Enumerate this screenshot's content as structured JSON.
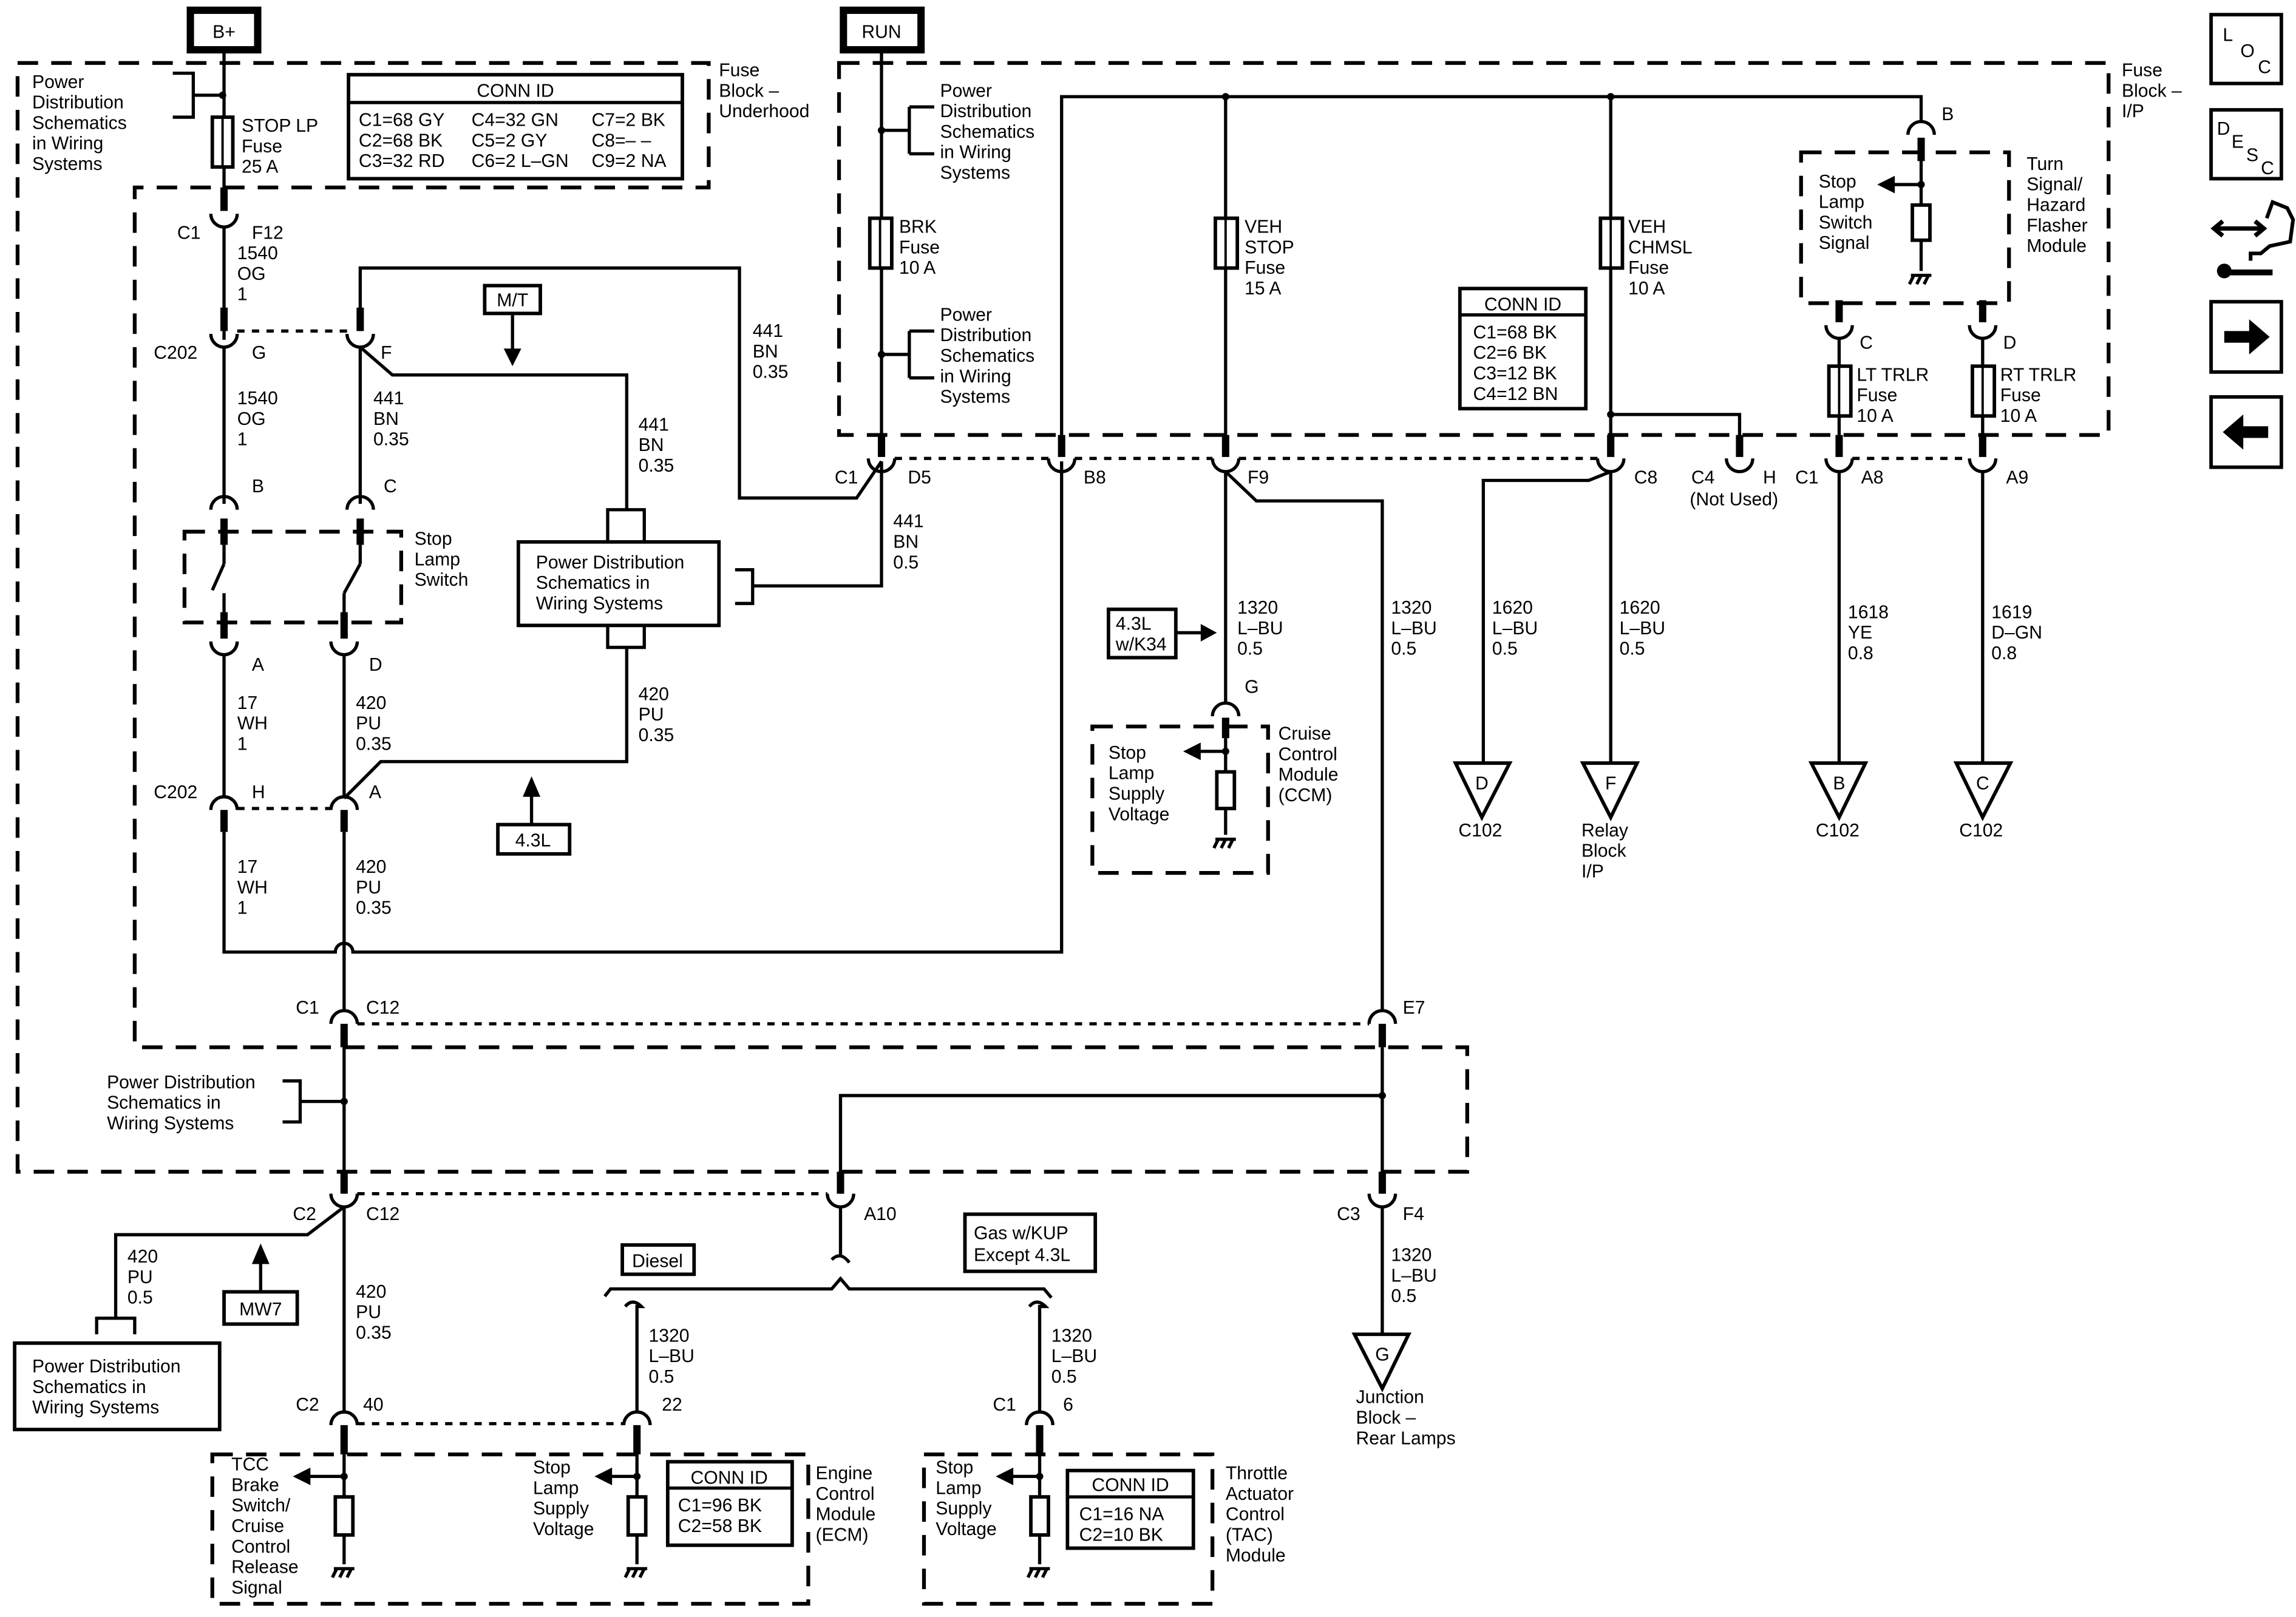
{
  "power_sources": {
    "bplus": "B+",
    "run": "RUN"
  },
  "fuse_block_underhood": {
    "label": [
      "Fuse",
      "Block –",
      "Underhood"
    ],
    "pds_ref": [
      "Power",
      "Distribution",
      "Schematics",
      "in Wiring",
      "Systems"
    ],
    "fuse": [
      "STOP LP",
      "Fuse",
      "25 A"
    ],
    "conn_id": {
      "title": "CONN ID",
      "rows": [
        [
          "C1=68 GY",
          "C4=32 GN",
          "C7=2 BK"
        ],
        [
          "C2=68 BK",
          "C5=2 GY",
          "C8=– –"
        ],
        [
          "C3=32 RD",
          "C6=2 L–GN",
          "C9=2 NA"
        ]
      ]
    },
    "conn_c1": "C1",
    "pin_f12": "F12"
  },
  "fuse_block_ip": {
    "label": [
      "Fuse",
      "Block –",
      "I/P"
    ],
    "pds_ref_1": [
      "Power",
      "Distribution",
      "Schematics",
      "in Wiring",
      "Systems"
    ],
    "pds_ref_2": [
      "Power",
      "Distribution",
      "Schematics",
      "in Wiring",
      "Systems"
    ],
    "brk_fuse": [
      "BRK",
      "Fuse",
      "10 A"
    ],
    "veh_stop_fuse": [
      "VEH",
      "STOP",
      "Fuse",
      "15 A"
    ],
    "veh_chmsl_fuse": [
      "VEH",
      "CHMSL",
      "Fuse",
      "10 A"
    ],
    "lt_trlr_fuse": [
      "LT TRLR",
      "Fuse",
      "10 A"
    ],
    "rt_trlr_fuse": [
      "RT TRLR",
      "Fuse",
      "10 A"
    ],
    "conn_id": {
      "title": "CONN ID",
      "rows": [
        "C1=68 BK",
        "C2=6 BK",
        "C3=12 BK",
        "C4=12 BN"
      ]
    },
    "pins": {
      "c1": "C1",
      "d5": "D5",
      "b8": "B8",
      "f9": "F9",
      "c8": "C8",
      "c4": "C4",
      "h": "H",
      "not_used": "(Not Used)",
      "c1b": "C1",
      "a8": "A8",
      "a9": "A9",
      "c12_conn": "C1",
      "c12": "C12",
      "e7": "E7"
    }
  },
  "turn_signal_module": {
    "label": [
      "Turn",
      "Signal/",
      "Hazard",
      "Flasher",
      "Module"
    ],
    "signal": [
      "Stop",
      "Lamp",
      "Switch",
      "Signal"
    ],
    "pins": {
      "b": "B",
      "c": "C",
      "d": "D"
    }
  },
  "stop_lamp_switch": {
    "label": [
      "Stop",
      "Lamp",
      "Switch"
    ],
    "pins": {
      "b": "B",
      "c": "C",
      "a": "A",
      "d": "D"
    }
  },
  "c202": {
    "label_top": "C202",
    "pin_g": "G",
    "pin_f": "F",
    "label_bot": "C202",
    "pin_h": "H",
    "pin_a": "A"
  },
  "option_tags": {
    "mt": "M/T",
    "l43": "4.3L",
    "l43_k34": [
      "4.3L",
      "w/K34"
    ],
    "mw7": "MW7",
    "diesel": "Diesel",
    "gas_kup": [
      "Gas w/KUP",
      "Except 4.3L"
    ]
  },
  "pds_box_center": [
    "Power Distribution",
    "Schematics in",
    "Wiring Systems"
  ],
  "pds_ref_lower": [
    "Power Distribution",
    "Schematics in",
    "Wiring Systems"
  ],
  "pds_box_lower": [
    "Power Distribution",
    "Schematics in",
    "Wiring Systems"
  ],
  "wires": {
    "w1540_top": [
      "1540",
      "OG",
      "1"
    ],
    "w1540_mid": [
      "1540",
      "OG",
      "1"
    ],
    "w441_f": [
      "441",
      "BN",
      "0.35"
    ],
    "w441_mt": [
      "441",
      "BN",
      "0.35"
    ],
    "w441_top": [
      "441",
      "BN",
      "0.35"
    ],
    "w441_d5": [
      "441",
      "BN",
      "0.5"
    ],
    "w17_a": [
      "17",
      "WH",
      "1"
    ],
    "w17_h": [
      "17",
      "WH",
      "1"
    ],
    "w420_d": [
      "420",
      "PU",
      "0.35"
    ],
    "w420_pds": [
      "420",
      "PU",
      "0.35"
    ],
    "w420_a": [
      "420",
      "PU",
      "0.35"
    ],
    "w420_c2": [
      "420",
      "PU",
      "0.5"
    ],
    "w420_c12": [
      "420",
      "PU",
      "0.35"
    ],
    "w1320_ccm": [
      "1320",
      "L–BU",
      "0.5"
    ],
    "w1320_e7": [
      "1320",
      "L–BU",
      "0.5"
    ],
    "w1620_d": [
      "1620",
      "L–BU",
      "0.5"
    ],
    "w1620_f": [
      "1620",
      "L–BU",
      "0.5"
    ],
    "w1618": [
      "1618",
      "YE",
      "0.8"
    ],
    "w1619": [
      "1619",
      "D–GN",
      "0.8"
    ],
    "w1320_ecm": [
      "1320",
      "L–BU",
      "0.5"
    ],
    "w1320_tac": [
      "1320",
      "L–BU",
      "0.5"
    ],
    "w1320_f4": [
      "1320",
      "L–BU",
      "0.5"
    ]
  },
  "ccm": {
    "label": [
      "Cruise",
      "Control",
      "Module",
      "(CCM)"
    ],
    "signal": [
      "Stop",
      "Lamp",
      "Supply",
      "Voltage"
    ],
    "pin_g": "G"
  },
  "c102_refs": [
    {
      "letter": "D",
      "label": [
        "C102"
      ]
    },
    {
      "letter": "F",
      "label": [
        "Relay",
        "Block",
        "I/P"
      ]
    },
    {
      "letter": "B",
      "label": [
        "C102"
      ]
    },
    {
      "letter": "C",
      "label": [
        "C102"
      ]
    }
  ],
  "junction_block": {
    "letter": "G",
    "label": [
      "Junction",
      "Block –",
      "Rear Lamps"
    ]
  },
  "lower_conns": {
    "c2": "C2",
    "c12": "C12",
    "a10": "A10",
    "c3": "C3",
    "f4": "F4"
  },
  "ecm": {
    "label": [
      "Engine",
      "Control",
      "Module",
      "(ECM)"
    ],
    "signal_tcc": [
      "TCC",
      "Brake",
      "Switch/",
      "Cruise",
      "Control",
      "Release",
      "Signal"
    ],
    "signal_stop": [
      "Stop",
      "Lamp",
      "Supply",
      "Voltage"
    ],
    "conn_id": {
      "title": "CONN ID",
      "rows": [
        "C1=96 BK",
        "C2=58 BK"
      ]
    },
    "pins": {
      "c2": "C2",
      "p40": "40",
      "p22": "22"
    }
  },
  "tac": {
    "label": [
      "Throttle",
      "Actuator",
      "Control",
      "(TAC)",
      "Module"
    ],
    "signal": [
      "Stop",
      "Lamp",
      "Supply",
      "Voltage"
    ],
    "conn_id": {
      "title": "CONN ID",
      "rows": [
        "C1=16 NA",
        "C2=10 BK"
      ]
    },
    "pins": {
      "c1": "C1",
      "p6": "6"
    }
  },
  "nav": {
    "loc": [
      "L",
      "O",
      "C"
    ],
    "desc": [
      "D",
      "E",
      "S",
      "C"
    ],
    "icons": [
      "location-button",
      "description-button",
      "connector-service-icon",
      "next-arrow-icon",
      "previous-arrow-icon"
    ]
  }
}
